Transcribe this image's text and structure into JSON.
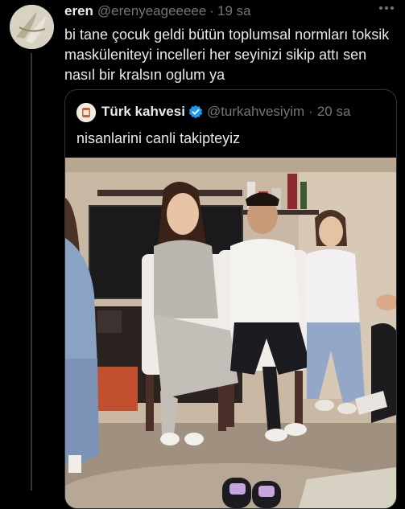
{
  "tweet": {
    "author_name": "eren",
    "author_handle": "@erenyeageeeee",
    "separator": "·",
    "time": "19 sa",
    "text": "bi tane çocuk geldi bütün toplumsal normları toksik maskülenitеyi incelleri her seyinizi sikip attı sen nasıl bir kralsın oglum ya"
  },
  "quote": {
    "author_name": "Türk kahvesi",
    "author_handle": "@turkahvesiyim",
    "separator": "·",
    "time": "20 sa",
    "text": "nisanlarini canli takipteyiz"
  },
  "colors": {
    "background": "#000000",
    "text_primary": "#e7e9ea",
    "text_secondary": "#71767b",
    "verified": "#1d9bf0",
    "border": "#2f3336"
  },
  "icons": {
    "more": "more-horizontal-icon",
    "verified": "verified-badge-icon"
  }
}
